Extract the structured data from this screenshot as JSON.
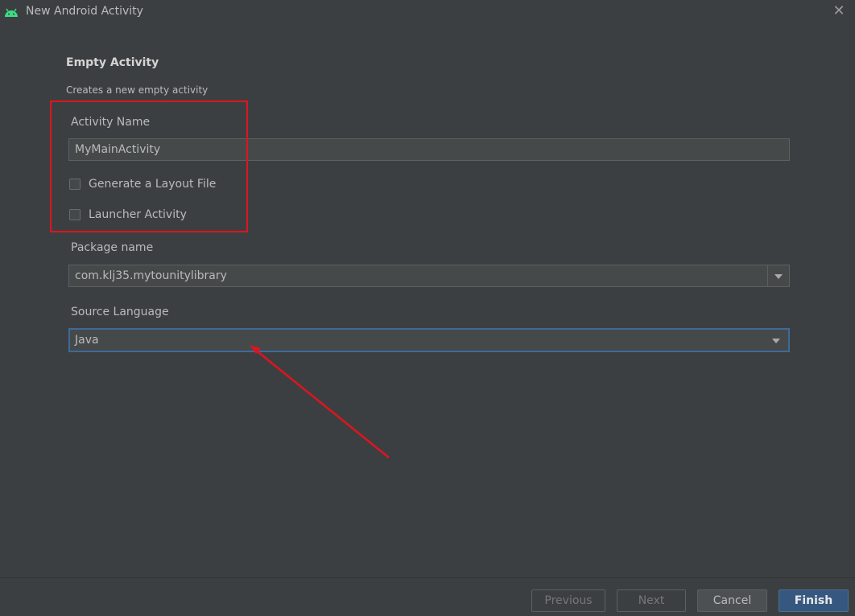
{
  "window": {
    "title": "New Android Activity",
    "close_symbol": "✕"
  },
  "form": {
    "heading": "Empty Activity",
    "subtitle": "Creates a new empty activity",
    "activity_name": {
      "label": "Activity Name",
      "value": "MyMainActivity"
    },
    "generate_layout": {
      "label": "Generate a Layout File",
      "checked": false
    },
    "launcher_activity": {
      "label": "Launcher Activity",
      "checked": false
    },
    "package_name": {
      "label": "Package name",
      "value": "com.klj35.mytounitylibrary"
    },
    "source_language": {
      "label": "Source Language",
      "value": "Java"
    }
  },
  "footer": {
    "previous_label": "Previous",
    "next_label": "Next",
    "cancel_label": "Cancel",
    "finish_label": "Finish"
  },
  "colors": {
    "background": "#3c3f41",
    "annotation_red": "#e0141e",
    "focus_blue": "#3d6a99",
    "primary_button": "#365880",
    "android_green": "#3ddc84"
  },
  "icons": {
    "app": "android-icon",
    "close": "close-icon",
    "dropdown": "chevron-down-icon"
  }
}
